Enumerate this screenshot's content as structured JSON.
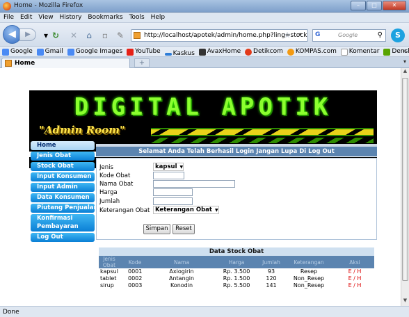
{
  "window": {
    "title": "Home - Mozilla Firefox",
    "min": "–",
    "max": "□",
    "close": "✕"
  },
  "menu": [
    "File",
    "Edit",
    "View",
    "History",
    "Bookmarks",
    "Tools",
    "Help"
  ],
  "nav": {
    "url": "http://localhost/apotek/admin/home.php?ling=stock",
    "search_placeholder": "Google",
    "search_engine": "G"
  },
  "bookmarks": [
    {
      "label": "Google",
      "color": "#4a8af4"
    },
    {
      "label": "Gmail",
      "color": "#4a8af4"
    },
    {
      "label": "Google Images",
      "color": "#4a8af4"
    },
    {
      "label": "YouTube",
      "color": "#e62117"
    },
    {
      "label": "Kaskus",
      "color": "#2e7dd7"
    },
    {
      "label": "AvaxHome",
      "color": "#333333"
    },
    {
      "label": "Detikcom",
      "color": "#e23a1a"
    },
    {
      "label": "KOMPAS.com",
      "color": "#f39a12"
    },
    {
      "label": "Komentar",
      "color": "#dddddd"
    },
    {
      "label": "Denshi Jisho",
      "color": "#57a300"
    }
  ],
  "bookmarks_more": "»",
  "tab": {
    "label": "Home",
    "new_tab": "+"
  },
  "status": "Done",
  "banner": {
    "logo": "DIGITAL APOTIK",
    "subtitle": "\"Admin Room\""
  },
  "sidebar": {
    "items": [
      "Home",
      "Jenis Obat",
      "Stock Obat",
      "Input Konsumen",
      "Input Admin",
      "Data Konsumen",
      "Piutang Penjualan",
      "Konfirmasi Pembayaran",
      "Log Out"
    ]
  },
  "main": {
    "header": "Selamat Anda Telah Berhasil Login Jangan Lupa Di Log Out",
    "form": {
      "jenis_label": "Jenis",
      "jenis_value": "kapsul",
      "kode_label": "Kode Obat",
      "nama_label": "Nama Obat",
      "harga_label": "Harga",
      "jumlah_label": "Jumlah",
      "keterangan_label": "Keterangan Obat",
      "keterangan_value": "Keterangan Obat",
      "save": "Simpan",
      "reset": "Reset"
    }
  },
  "stock": {
    "title": "Data Stock Obat",
    "columns": [
      "Jenis Obat",
      "Kode",
      "Nama",
      "Harga",
      "Jumlah",
      "Keterangan",
      "Aksi"
    ],
    "rows": [
      [
        "kapsul",
        "0001",
        "Axiogirin",
        "Rp. 3.500",
        "93",
        "Resep",
        "E / H"
      ],
      [
        "tablet",
        "0002",
        "Antangin",
        "Rp. 1.500",
        "120",
        "Non_Resep",
        "E / H"
      ],
      [
        "sirup",
        "0003",
        "Konodin",
        "Rp. 5.500",
        "141",
        "Non_Resep",
        "E / H"
      ]
    ]
  }
}
